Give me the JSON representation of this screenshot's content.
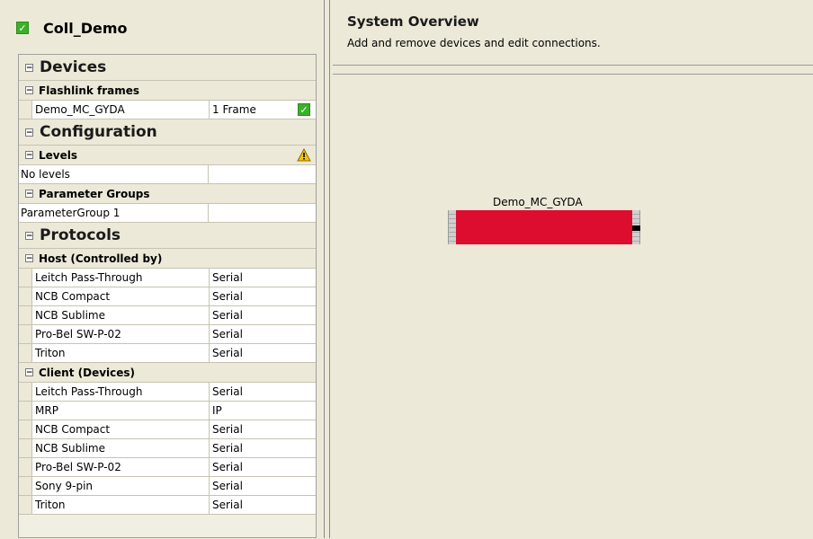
{
  "project": {
    "name": "Coll_Demo",
    "status_icon": "check-icon"
  },
  "devices": {
    "label": "Devices",
    "flashlink": {
      "label": "Flashlink frames",
      "rows": [
        {
          "name": "Demo_MC_GYDA",
          "value": "1 Frame"
        }
      ]
    }
  },
  "configuration": {
    "label": "Configuration",
    "levels": {
      "label": "Levels",
      "rows": [
        {
          "name": "No levels",
          "value": ""
        }
      ]
    },
    "parameter_groups": {
      "label": "Parameter Groups",
      "rows": [
        {
          "name": "ParameterGroup 1",
          "value": ""
        }
      ]
    }
  },
  "protocols": {
    "label": "Protocols",
    "host": {
      "label": "Host (Controlled by)",
      "rows": [
        {
          "name": "Leitch Pass-Through",
          "value": "Serial"
        },
        {
          "name": "NCB Compact",
          "value": "Serial"
        },
        {
          "name": "NCB Sublime",
          "value": "Serial"
        },
        {
          "name": "Pro-Bel SW-P-02",
          "value": "Serial"
        },
        {
          "name": "Triton",
          "value": "Serial"
        }
      ]
    },
    "client": {
      "label": "Client (Devices)",
      "rows": [
        {
          "name": "Leitch Pass-Through",
          "value": "Serial"
        },
        {
          "name": "MRP",
          "value": "IP"
        },
        {
          "name": "NCB Compact",
          "value": "Serial"
        },
        {
          "name": "NCB Sublime",
          "value": "Serial"
        },
        {
          "name": "Pro-Bel SW-P-02",
          "value": "Serial"
        },
        {
          "name": "Sony 9-pin",
          "value": "Serial"
        },
        {
          "name": "Triton",
          "value": "Serial"
        }
      ]
    }
  },
  "overview": {
    "title": "System Overview",
    "subtitle": "Add and remove devices and edit connections.",
    "device": {
      "label": "Demo_MC_GYDA",
      "color": "#dc0d2e"
    }
  },
  "icons": {
    "collapse": "−",
    "check": "✓",
    "warning": "warning-icon"
  },
  "colors": {
    "panel_bg": "#ece9d8",
    "check_green": "#3cb029",
    "device_red": "#dc0d2e"
  }
}
